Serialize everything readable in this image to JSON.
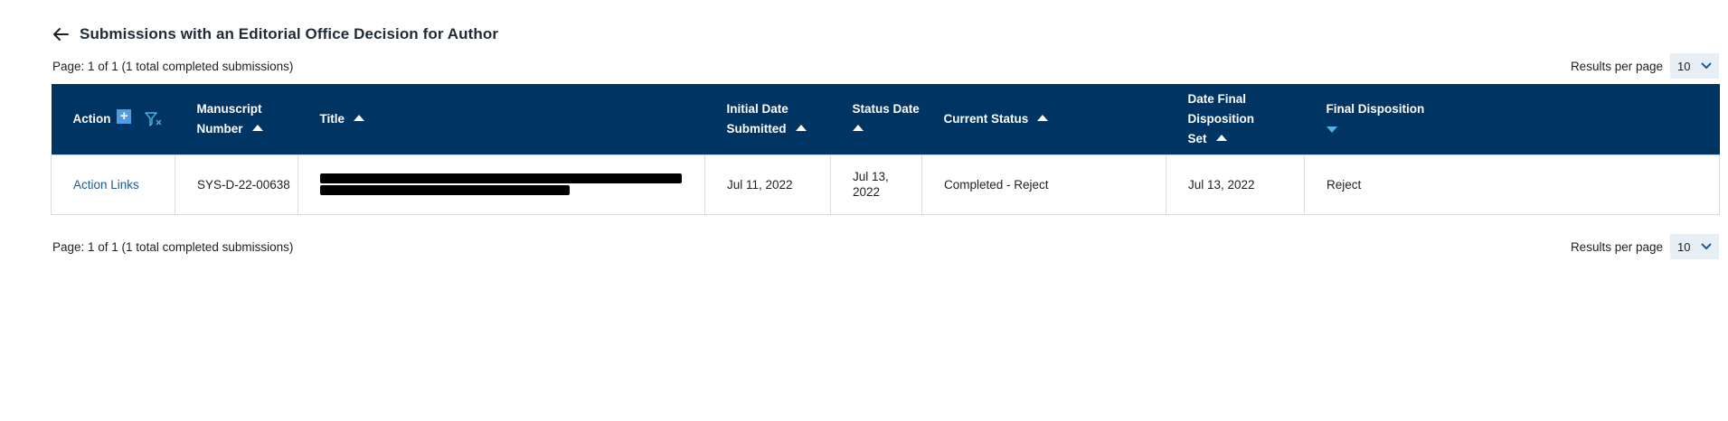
{
  "header": {
    "title": "Submissions with an Editorial Office Decision for Author",
    "back_icon": "arrow-left-icon"
  },
  "pagination_top": {
    "info": "Page: 1 of 1 (1 total completed submissions)",
    "rpp_label": "Results per page",
    "rpp_value": "10"
  },
  "pagination_bottom": {
    "info": "Page: 1 of 1 (1 total completed submissions)",
    "rpp_label": "Results per page",
    "rpp_value": "10"
  },
  "table": {
    "header_bg": "#003462",
    "columns": {
      "action": "Action",
      "manuscript_1": "Manuscript",
      "manuscript_2": "Number",
      "title": "Title",
      "initial_1": "Initial Date",
      "initial_2": "Submitted",
      "status_date": "Status Date",
      "current_status": "Current Status",
      "final_set_1": "Date Final Disposition",
      "final_set_2": "Set",
      "final_disposition": "Final Disposition"
    },
    "rows": [
      {
        "action": "Action Links",
        "manuscript_number": "SYS-D-22-00638",
        "title_redacted": true,
        "initial_date": "Jul 11, 2022",
        "status_date_1": "Jul 13,",
        "status_date_2": "2022",
        "current_status": "Completed - Reject",
        "final_set": "Jul 13, 2022",
        "final_disposition": "Reject"
      }
    ]
  }
}
